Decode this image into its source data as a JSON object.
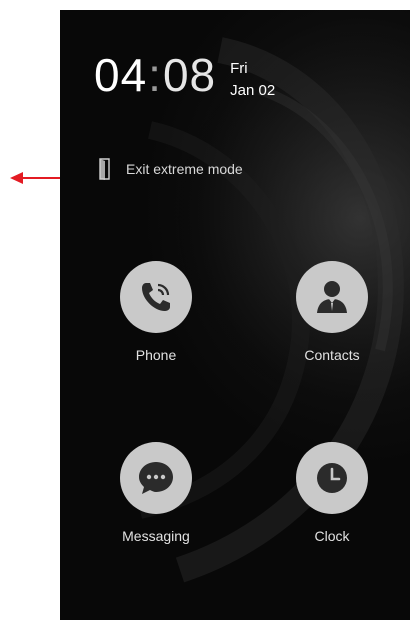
{
  "status": {
    "time_hours": "04",
    "time_separator": ":",
    "time_minutes": "08",
    "day": "Fri",
    "date": "Jan 02"
  },
  "exit": {
    "label": "Exit extreme mode",
    "icon": "exit-door-icon"
  },
  "apps": [
    {
      "label": "Phone",
      "icon": "phone-icon"
    },
    {
      "label": "Contacts",
      "icon": "contact-person-icon"
    },
    {
      "label": "Messaging",
      "icon": "message-bubble-icon"
    },
    {
      "label": "Clock",
      "icon": "clock-icon"
    }
  ],
  "colors": {
    "annotation_arrow": "#e31b23",
    "app_circle": "#c9c9c9",
    "icon_dark": "#2b2b2b",
    "screen_background": "#0c0c0c"
  }
}
